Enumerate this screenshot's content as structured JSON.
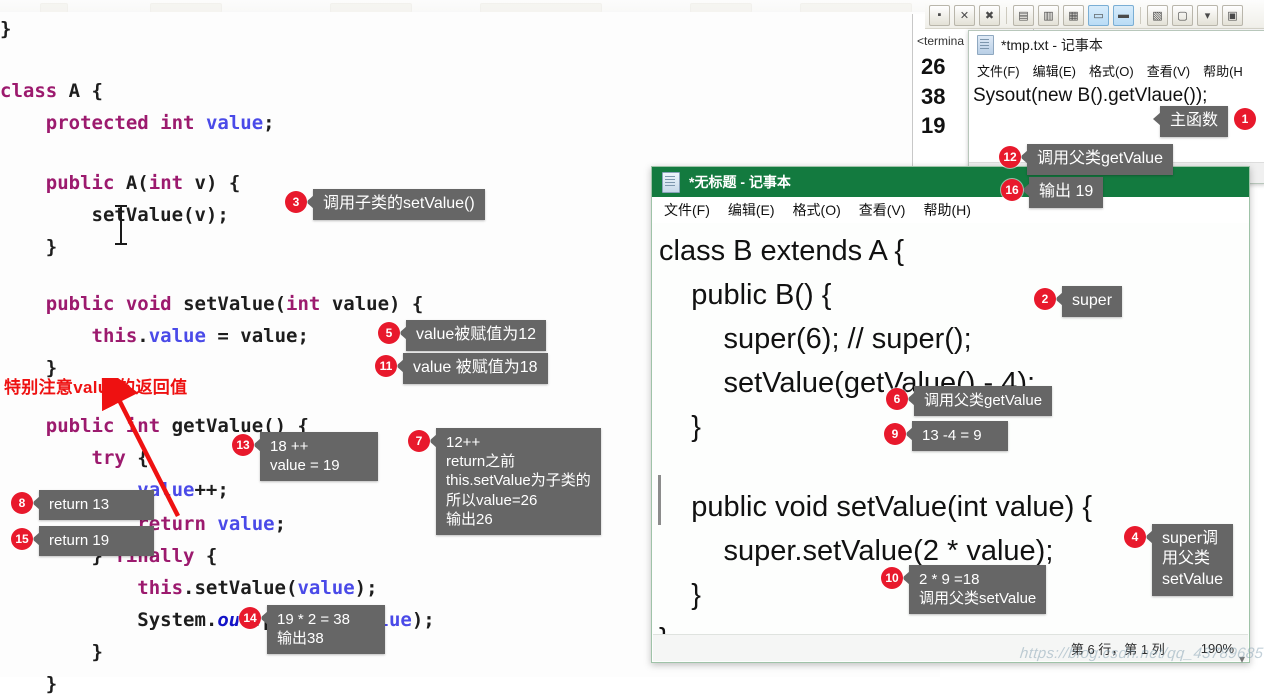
{
  "editor": {
    "lines": [
      "}",
      "class A {",
      "    protected int value;",
      "    public A(int v) {",
      "        setValue(v);",
      "    }",
      "    public void setValue(int value) {",
      "        this.value = value;",
      "    }",
      "    public int getValue() {",
      "        try {",
      "            value++;",
      "            return value;",
      "        } finally {",
      "            this.setValue(value);",
      "            System.out.println(value);",
      "        }",
      "    }",
      "}"
    ],
    "red_note": "特别注意value的返回值"
  },
  "console": {
    "label": "<termina",
    "outputs": [
      "26",
      "38",
      "19"
    ]
  },
  "toolbar": {
    "icons": [
      "stop-icon",
      "terminate-icon",
      "remove-all-icon",
      "sep",
      "console-clear-icon",
      "lock-scroll-icon",
      "word-wrap-icon",
      "pin-console-icon",
      "display-selected-console-icon",
      "sep",
      "open-console-icon",
      "new-console-icon",
      "console-dropdown-icon",
      "new-window-icon"
    ]
  },
  "tmp_window": {
    "title": "*tmp.txt - 记事本",
    "menu": [
      "文件(F)",
      "编辑(E)",
      "格式(O)",
      "查看(V)",
      "帮助(H"
    ],
    "text": "Sysout(new B().getVlaue());"
  },
  "notepad": {
    "title": "*无标题 - 记事本",
    "menu": [
      "文件(F)",
      "编辑(E)",
      "格式(O)",
      "查看(V)",
      "帮助(H)"
    ],
    "code": [
      "class B extends A {",
      "    public B() {",
      "        super(6); // super();",
      "        setValue(getValue() - 4);",
      "    }",
      "",
      "    public void setValue(int value) {",
      "        super.setValue(2 * value);",
      "    }",
      "}"
    ],
    "status": {
      "position": "第 6 行，第 1 列",
      "zoom": "190%"
    },
    "scroll_down_icon": "▾"
  },
  "callouts": [
    {
      "n": "1",
      "text": "主函数"
    },
    {
      "n": "2",
      "text": "super"
    },
    {
      "n": "3",
      "text": "调用子类的setValue()"
    },
    {
      "n": "4",
      "text": "super调\n用父类\nsetValue"
    },
    {
      "n": "5",
      "text": "value被赋值为12"
    },
    {
      "n": "6",
      "text": "调用父类getValue"
    },
    {
      "n": "7",
      "text": "12++\nreturn之前\nthis.setValue为子类的\n所以value=26\n输出26"
    },
    {
      "n": "8",
      "text": "return 13"
    },
    {
      "n": "9",
      "text": "13 -4 = 9"
    },
    {
      "n": "10",
      "text": "2 * 9 =18\n调用父类setValue"
    },
    {
      "n": "11",
      "text": "value 被赋值为18"
    },
    {
      "n": "12",
      "text": "调用父类getValue"
    },
    {
      "n": "13",
      "text": "18 ++\nvalue = 19"
    },
    {
      "n": "14",
      "text": "19 * 2 = 38\n输出38"
    },
    {
      "n": "15",
      "text": "return 19"
    },
    {
      "n": "16",
      "text": "输出 19"
    }
  ],
  "watermark": "https://blog.csdn.net/qq_43789685",
  "colors": {
    "badge": "#e8192c",
    "tip_bg": "#666666",
    "notepad_title_bg": "#137a3f",
    "keyword": "#9c1a6e",
    "field": "#4a4ae8",
    "red_note": "#ee1111"
  }
}
